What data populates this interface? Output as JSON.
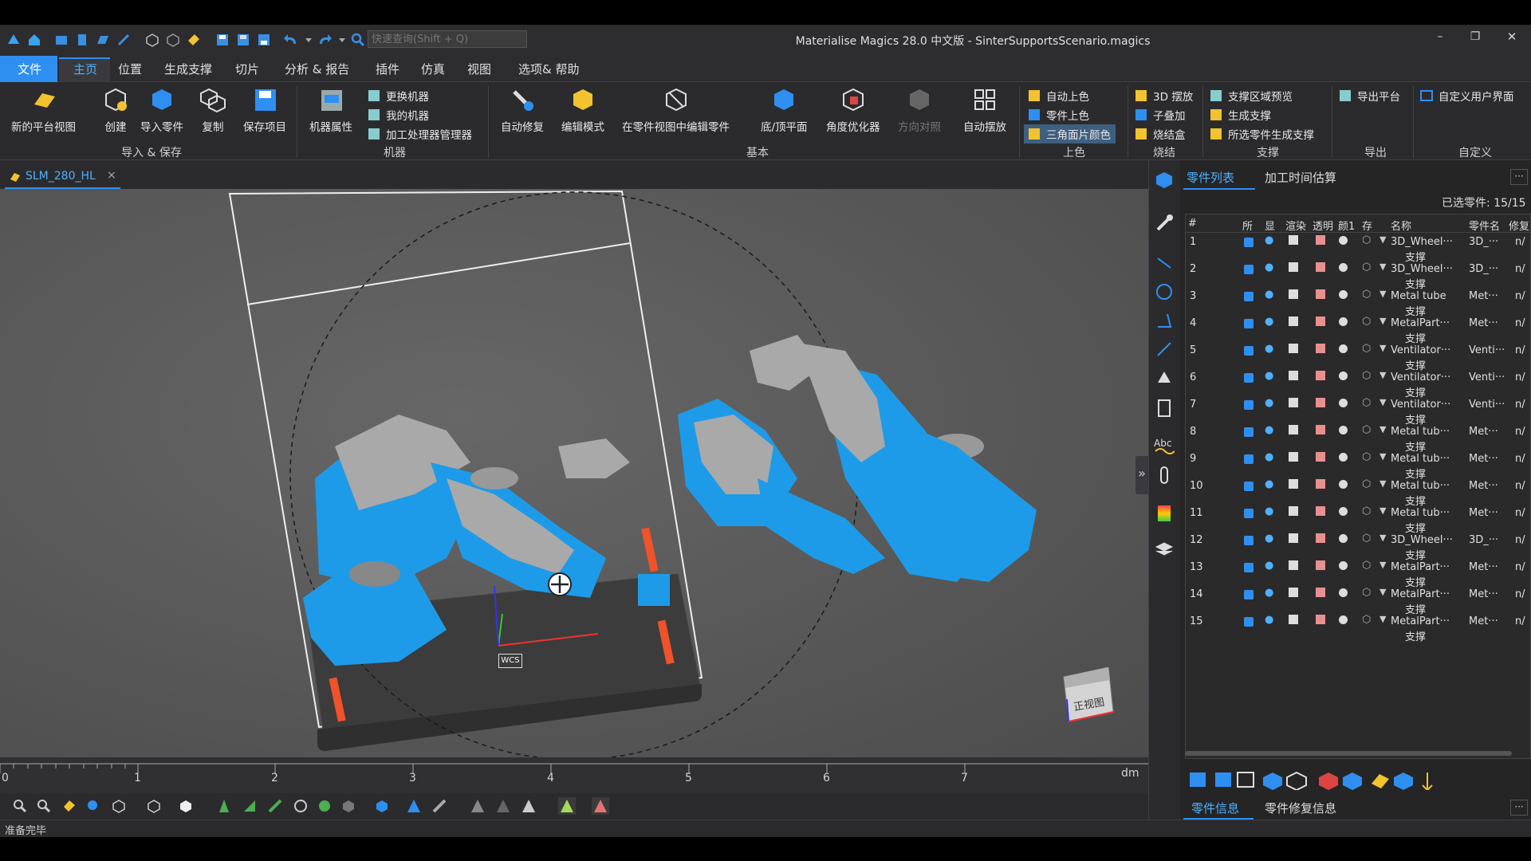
{
  "window": {
    "title": "Materialise Magics 28.0 中文版 - SinterSupportsScenario.magics",
    "search_placeholder": "快速查询(Shift + Q)",
    "controls": {
      "minimize": "–",
      "maximize": "❐",
      "close": "✕"
    }
  },
  "menu": {
    "items": [
      "文件",
      "主页",
      "位置",
      "生成支撑",
      "切片",
      "分析 & 报告",
      "插件",
      "仿真",
      "视图",
      "选项& 帮助"
    ],
    "active": "主页"
  },
  "ribbon": {
    "groups": {
      "import_save": {
        "label": "导入 & 保存",
        "buttons": [
          "新的平台视图",
          "创建",
          "导入零件",
          "复制",
          "保存项目"
        ]
      },
      "machine": {
        "label": "机器",
        "big": "机器属性",
        "small": [
          "更换机器",
          "我的机器",
          "加工处理器管理器"
        ]
      },
      "basic": {
        "label": "基本",
        "buttons": [
          "自动修复",
          "编辑模式",
          "在零件视图中编辑零件",
          "底/顶平面",
          "角度优化器",
          "方向对照",
          "自动摆放"
        ]
      },
      "color": {
        "label": "上色",
        "small": [
          "自动上色",
          "零件上色",
          "三角面片颜色"
        ]
      },
      "sinter": {
        "label": "烧结",
        "small": [
          "3D 摆放",
          "子叠加",
          "烧结盒"
        ]
      },
      "support": {
        "label": "支撑",
        "small": [
          "支撑区域预览",
          "生成支撑",
          "所选零件生成支撑"
        ]
      },
      "export": {
        "label": "导出",
        "small": [
          "导出平台"
        ]
      },
      "custom": {
        "label": "自定义",
        "small": [
          "自定义用户界面"
        ]
      }
    }
  },
  "doc_tab": {
    "label": "SLM_280_HL",
    "close": "×"
  },
  "viewport": {
    "wcs_label": "WCS",
    "viewcube_label": "正视图",
    "expand_arrow": "»",
    "part_color": "#1e9be8",
    "part_gray": "#a9a9a9"
  },
  "ruler": {
    "ticks": [
      "0",
      "1",
      "2",
      "3",
      "4",
      "5",
      "6",
      "7"
    ],
    "unit": "dm"
  },
  "status": {
    "text": "准备完毕"
  },
  "panel": {
    "tabs": [
      "零件列表",
      "加工时间估算"
    ],
    "selected_count": "已选零件: 15/15",
    "headers": [
      "#",
      "所",
      "显",
      "渲染",
      "透明",
      "颜1",
      "存",
      "名称",
      "零件名",
      "修复"
    ],
    "rows": [
      {
        "n": "1",
        "name": "3D_Wheel···",
        "sub": "支撑",
        "part": "3D_···",
        "fix": "n/"
      },
      {
        "n": "2",
        "name": "3D_Wheel···",
        "sub": "支撑",
        "part": "3D_···",
        "fix": "n/"
      },
      {
        "n": "3",
        "name": "Metal tube",
        "sub": "支撑",
        "part": "Met···",
        "fix": "n/"
      },
      {
        "n": "4",
        "name": "MetalPart···",
        "sub": "支撑",
        "part": "Met···",
        "fix": "n/"
      },
      {
        "n": "5",
        "name": "Ventilator···",
        "sub": "支撑",
        "part": "Venti···",
        "fix": "n/"
      },
      {
        "n": "6",
        "name": "Ventilator···",
        "sub": "支撑",
        "part": "Venti···",
        "fix": "n/"
      },
      {
        "n": "7",
        "name": "Ventilator···",
        "sub": "支撑",
        "part": "Venti···",
        "fix": "n/"
      },
      {
        "n": "8",
        "name": "Metal tub···",
        "sub": "支撑",
        "part": "Met···",
        "fix": "n/"
      },
      {
        "n": "9",
        "name": "Metal tub···",
        "sub": "支撑",
        "part": "Met···",
        "fix": "n/"
      },
      {
        "n": "10",
        "name": "Metal tub···",
        "sub": "支撑",
        "part": "Met···",
        "fix": "n/"
      },
      {
        "n": "11",
        "name": "Metal tub···",
        "sub": "支撑",
        "part": "Met···",
        "fix": "n/"
      },
      {
        "n": "12",
        "name": "3D_Wheel···",
        "sub": "支撑",
        "part": "3D_···",
        "fix": "n/"
      },
      {
        "n": "13",
        "name": "MetalPart···",
        "sub": "支撑",
        "part": "Met···",
        "fix": "n/"
      },
      {
        "n": "14",
        "name": "MetalPart···",
        "sub": "支撑",
        "part": "Met···",
        "fix": "n/"
      },
      {
        "n": "15",
        "name": "MetalPart···",
        "sub": "支撑",
        "part": "Met···",
        "fix": "n/"
      }
    ],
    "bottom_tabs": [
      "零件信息",
      "零件修复信息"
    ],
    "more": "···"
  }
}
